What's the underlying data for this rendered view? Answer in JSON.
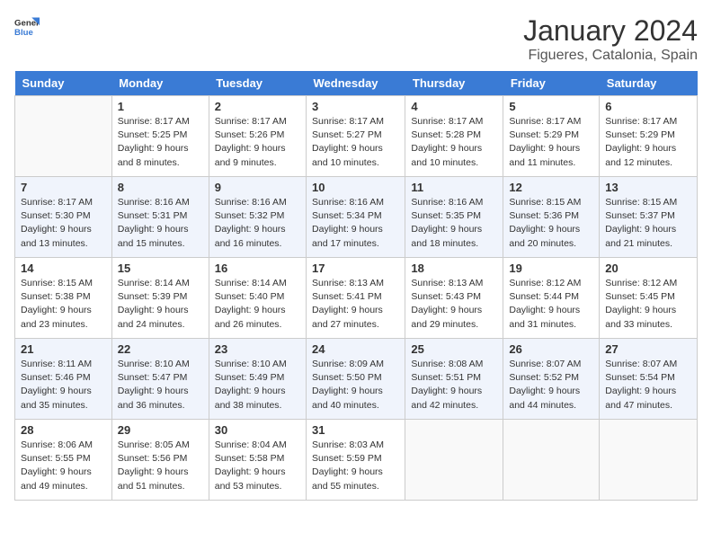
{
  "logo": {
    "line1": "General",
    "line2": "Blue"
  },
  "title": "January 2024",
  "subtitle": "Figueres, Catalonia, Spain",
  "headers": [
    "Sunday",
    "Monday",
    "Tuesday",
    "Wednesday",
    "Thursday",
    "Friday",
    "Saturday"
  ],
  "weeks": [
    [
      {
        "day": "",
        "sunrise": "",
        "sunset": "",
        "daylight": ""
      },
      {
        "day": "1",
        "sunrise": "Sunrise: 8:17 AM",
        "sunset": "Sunset: 5:25 PM",
        "daylight": "Daylight: 9 hours and 8 minutes."
      },
      {
        "day": "2",
        "sunrise": "Sunrise: 8:17 AM",
        "sunset": "Sunset: 5:26 PM",
        "daylight": "Daylight: 9 hours and 9 minutes."
      },
      {
        "day": "3",
        "sunrise": "Sunrise: 8:17 AM",
        "sunset": "Sunset: 5:27 PM",
        "daylight": "Daylight: 9 hours and 10 minutes."
      },
      {
        "day": "4",
        "sunrise": "Sunrise: 8:17 AM",
        "sunset": "Sunset: 5:28 PM",
        "daylight": "Daylight: 9 hours and 10 minutes."
      },
      {
        "day": "5",
        "sunrise": "Sunrise: 8:17 AM",
        "sunset": "Sunset: 5:29 PM",
        "daylight": "Daylight: 9 hours and 11 minutes."
      },
      {
        "day": "6",
        "sunrise": "Sunrise: 8:17 AM",
        "sunset": "Sunset: 5:29 PM",
        "daylight": "Daylight: 9 hours and 12 minutes."
      }
    ],
    [
      {
        "day": "7",
        "sunrise": "Sunrise: 8:17 AM",
        "sunset": "Sunset: 5:30 PM",
        "daylight": "Daylight: 9 hours and 13 minutes."
      },
      {
        "day": "8",
        "sunrise": "Sunrise: 8:16 AM",
        "sunset": "Sunset: 5:31 PM",
        "daylight": "Daylight: 9 hours and 15 minutes."
      },
      {
        "day": "9",
        "sunrise": "Sunrise: 8:16 AM",
        "sunset": "Sunset: 5:32 PM",
        "daylight": "Daylight: 9 hours and 16 minutes."
      },
      {
        "day": "10",
        "sunrise": "Sunrise: 8:16 AM",
        "sunset": "Sunset: 5:34 PM",
        "daylight": "Daylight: 9 hours and 17 minutes."
      },
      {
        "day": "11",
        "sunrise": "Sunrise: 8:16 AM",
        "sunset": "Sunset: 5:35 PM",
        "daylight": "Daylight: 9 hours and 18 minutes."
      },
      {
        "day": "12",
        "sunrise": "Sunrise: 8:15 AM",
        "sunset": "Sunset: 5:36 PM",
        "daylight": "Daylight: 9 hours and 20 minutes."
      },
      {
        "day": "13",
        "sunrise": "Sunrise: 8:15 AM",
        "sunset": "Sunset: 5:37 PM",
        "daylight": "Daylight: 9 hours and 21 minutes."
      }
    ],
    [
      {
        "day": "14",
        "sunrise": "Sunrise: 8:15 AM",
        "sunset": "Sunset: 5:38 PM",
        "daylight": "Daylight: 9 hours and 23 minutes."
      },
      {
        "day": "15",
        "sunrise": "Sunrise: 8:14 AM",
        "sunset": "Sunset: 5:39 PM",
        "daylight": "Daylight: 9 hours and 24 minutes."
      },
      {
        "day": "16",
        "sunrise": "Sunrise: 8:14 AM",
        "sunset": "Sunset: 5:40 PM",
        "daylight": "Daylight: 9 hours and 26 minutes."
      },
      {
        "day": "17",
        "sunrise": "Sunrise: 8:13 AM",
        "sunset": "Sunset: 5:41 PM",
        "daylight": "Daylight: 9 hours and 27 minutes."
      },
      {
        "day": "18",
        "sunrise": "Sunrise: 8:13 AM",
        "sunset": "Sunset: 5:43 PM",
        "daylight": "Daylight: 9 hours and 29 minutes."
      },
      {
        "day": "19",
        "sunrise": "Sunrise: 8:12 AM",
        "sunset": "Sunset: 5:44 PM",
        "daylight": "Daylight: 9 hours and 31 minutes."
      },
      {
        "day": "20",
        "sunrise": "Sunrise: 8:12 AM",
        "sunset": "Sunset: 5:45 PM",
        "daylight": "Daylight: 9 hours and 33 minutes."
      }
    ],
    [
      {
        "day": "21",
        "sunrise": "Sunrise: 8:11 AM",
        "sunset": "Sunset: 5:46 PM",
        "daylight": "Daylight: 9 hours and 35 minutes."
      },
      {
        "day": "22",
        "sunrise": "Sunrise: 8:10 AM",
        "sunset": "Sunset: 5:47 PM",
        "daylight": "Daylight: 9 hours and 36 minutes."
      },
      {
        "day": "23",
        "sunrise": "Sunrise: 8:10 AM",
        "sunset": "Sunset: 5:49 PM",
        "daylight": "Daylight: 9 hours and 38 minutes."
      },
      {
        "day": "24",
        "sunrise": "Sunrise: 8:09 AM",
        "sunset": "Sunset: 5:50 PM",
        "daylight": "Daylight: 9 hours and 40 minutes."
      },
      {
        "day": "25",
        "sunrise": "Sunrise: 8:08 AM",
        "sunset": "Sunset: 5:51 PM",
        "daylight": "Daylight: 9 hours and 42 minutes."
      },
      {
        "day": "26",
        "sunrise": "Sunrise: 8:07 AM",
        "sunset": "Sunset: 5:52 PM",
        "daylight": "Daylight: 9 hours and 44 minutes."
      },
      {
        "day": "27",
        "sunrise": "Sunrise: 8:07 AM",
        "sunset": "Sunset: 5:54 PM",
        "daylight": "Daylight: 9 hours and 47 minutes."
      }
    ],
    [
      {
        "day": "28",
        "sunrise": "Sunrise: 8:06 AM",
        "sunset": "Sunset: 5:55 PM",
        "daylight": "Daylight: 9 hours and 49 minutes."
      },
      {
        "day": "29",
        "sunrise": "Sunrise: 8:05 AM",
        "sunset": "Sunset: 5:56 PM",
        "daylight": "Daylight: 9 hours and 51 minutes."
      },
      {
        "day": "30",
        "sunrise": "Sunrise: 8:04 AM",
        "sunset": "Sunset: 5:58 PM",
        "daylight": "Daylight: 9 hours and 53 minutes."
      },
      {
        "day": "31",
        "sunrise": "Sunrise: 8:03 AM",
        "sunset": "Sunset: 5:59 PM",
        "daylight": "Daylight: 9 hours and 55 minutes."
      },
      {
        "day": "",
        "sunrise": "",
        "sunset": "",
        "daylight": ""
      },
      {
        "day": "",
        "sunrise": "",
        "sunset": "",
        "daylight": ""
      },
      {
        "day": "",
        "sunrise": "",
        "sunset": "",
        "daylight": ""
      }
    ]
  ]
}
